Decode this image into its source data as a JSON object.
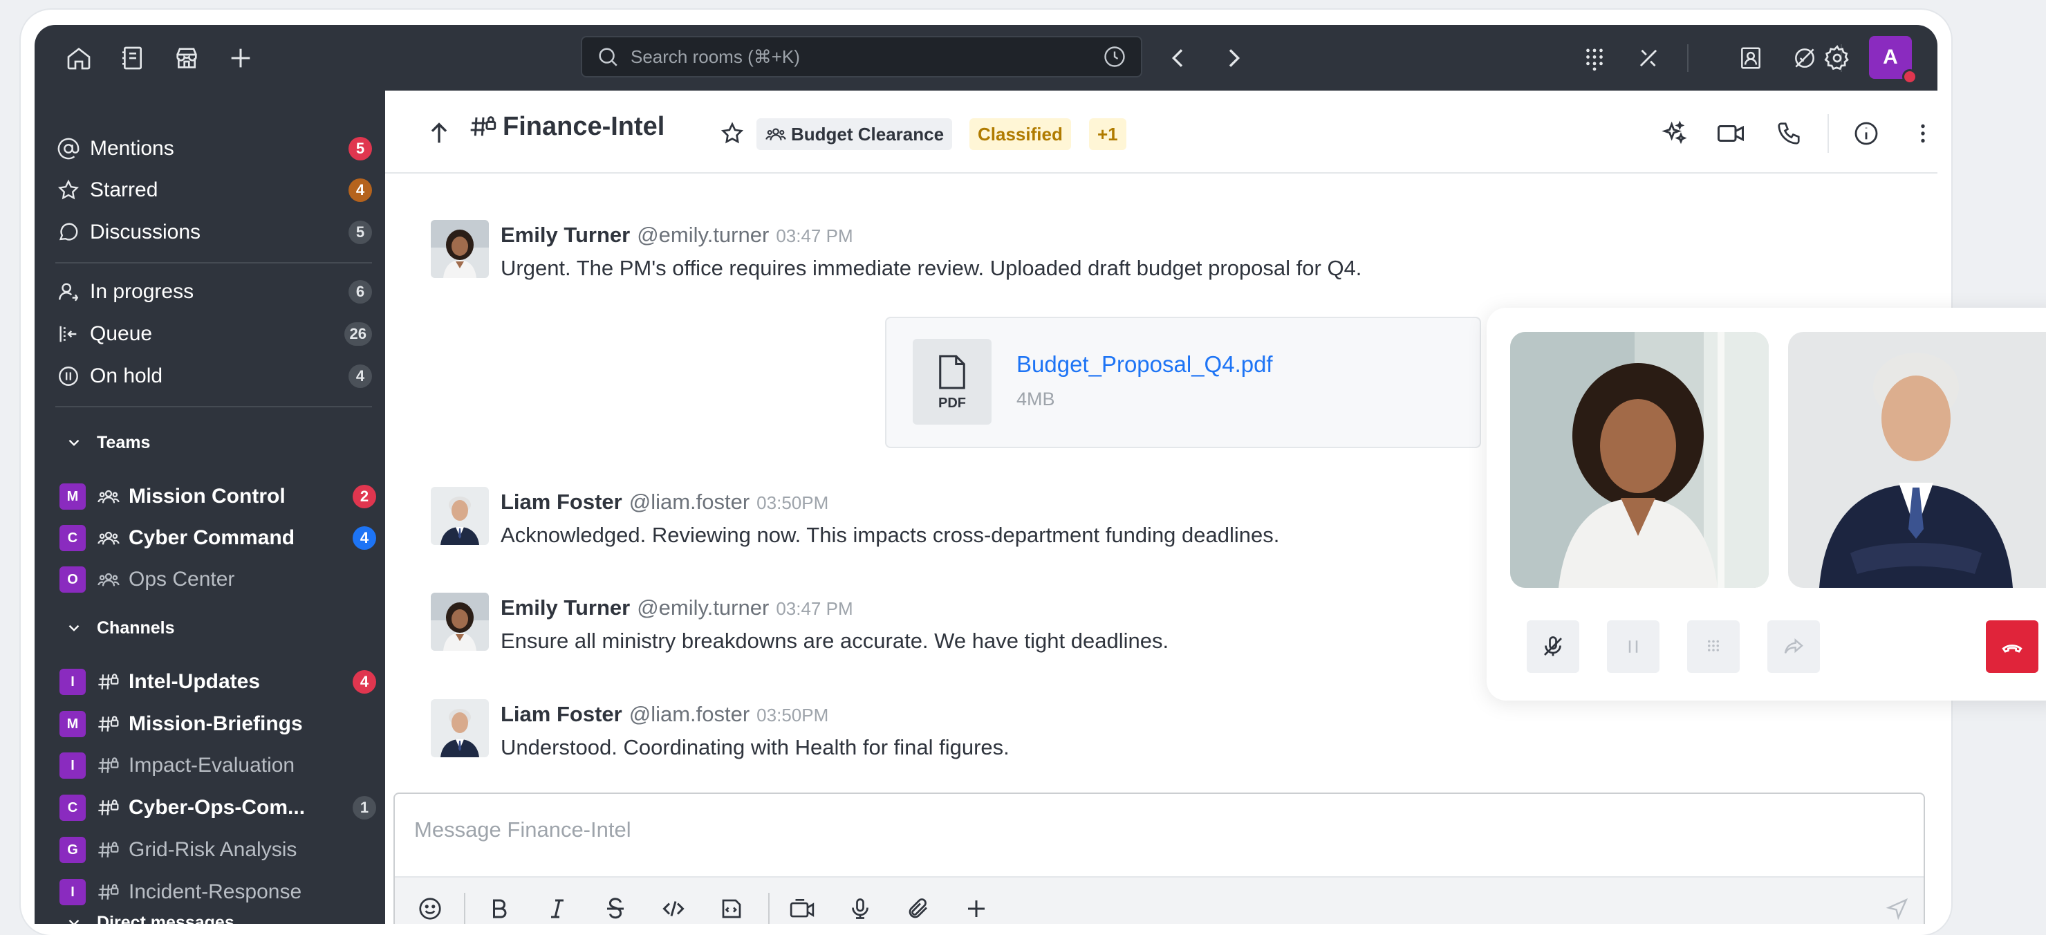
{
  "topbar": {
    "search_placeholder": "Search rooms (⌘+K)",
    "user_initial": "A"
  },
  "sidebar": {
    "items": [
      {
        "label": "Mentions",
        "badge": "5",
        "icon": "at-icon"
      },
      {
        "label": "Starred",
        "badge": "4",
        "icon": "star-icon"
      },
      {
        "label": "Discussions",
        "badge": "5",
        "icon": "discussion-icon"
      },
      {
        "label": "In progress",
        "badge": "6",
        "icon": "user-progress-icon"
      },
      {
        "label": "Queue",
        "badge": "26",
        "icon": "queue-icon"
      },
      {
        "label": "On hold",
        "badge": "4",
        "icon": "pause-circle-icon"
      }
    ],
    "teams_header": "Teams",
    "teams": [
      {
        "initial": "M",
        "label": "Mission Control",
        "badge": "2"
      },
      {
        "initial": "C",
        "label": "Cyber Command",
        "badge": "4"
      },
      {
        "initial": "O",
        "label": "Ops Center",
        "badge": ""
      }
    ],
    "channels_header": "Channels",
    "channels": [
      {
        "initial": "I",
        "label": "Intel-Updates",
        "badge": "4"
      },
      {
        "initial": "M",
        "label": "Mission-Briefings",
        "badge": ""
      },
      {
        "initial": "I",
        "label": "Impact-Evaluation",
        "badge": ""
      },
      {
        "initial": "C",
        "label": "Cyber-Ops-Com...",
        "badge": "1"
      },
      {
        "initial": "G",
        "label": "Grid-Risk Analysis",
        "badge": ""
      },
      {
        "initial": "I",
        "label": "Incident-Response",
        "badge": ""
      }
    ],
    "dm_header": "Direct messages"
  },
  "room": {
    "name": "Finance-Intel",
    "team_chip": "Budget Clearance",
    "classified_chip": "Classified",
    "more_chip": "+1"
  },
  "messages": [
    {
      "name": "Emily Turner",
      "username": "@emily.turner",
      "time": "03:47 PM",
      "text": "Urgent. The PM's office requires immediate review. Uploaded draft budget proposal for Q4."
    },
    {
      "name": "Liam Foster",
      "username": "@liam.foster",
      "time": "03:50PM",
      "text": "Acknowledged. Reviewing now. This impacts cross-department funding deadlines."
    },
    {
      "name": "Emily Turner",
      "username": "@emily.turner",
      "time": "03:47 PM",
      "text": "Ensure all ministry breakdowns are accurate. We have tight deadlines."
    },
    {
      "name": "Liam Foster",
      "username": "@liam.foster",
      "time": "03:50PM",
      "text": "Understood. Coordinating with Health for final figures."
    }
  ],
  "attachment": {
    "type_label": "PDF",
    "file_name": "Budget_Proposal_Q4.pdf",
    "file_size": "4MB"
  },
  "composer": {
    "placeholder": "Message Finance-Intel"
  },
  "colors": {
    "sidebar_bg": "#2f343d",
    "accent": "#1d74f5",
    "badge_red": "#e0364f",
    "room_avatar": "#8a2bbf",
    "end_call": "#e0243a"
  }
}
